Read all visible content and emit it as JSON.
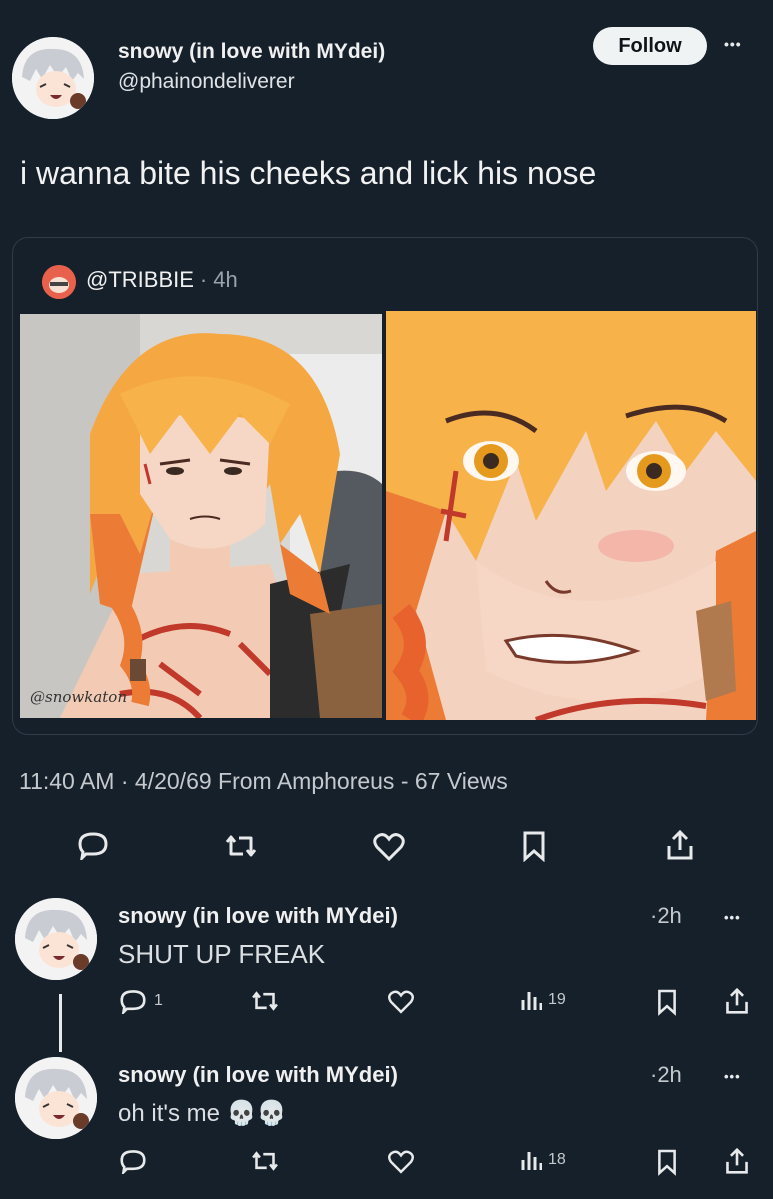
{
  "main_tweet": {
    "display_name": "snowy (in love with MYdei)",
    "handle": "@phainondeliverer",
    "follow_label": "Follow",
    "more_label": "•••",
    "text": "i wanna bite his cheeks and lick his nose",
    "quoted": {
      "handle": "@TRIBBIE",
      "separator": "·",
      "age": "4h",
      "signature": "@snowkaton"
    },
    "meta": "11:40 AM · 4/20/69 From Amphoreus - 67 Views"
  },
  "replies": [
    {
      "display_name": "snowy (in love with MYdei)",
      "age": "·2h",
      "text": "SHUT UP FREAK",
      "reply_count": "1",
      "views": "19",
      "more_label": "•••"
    },
    {
      "display_name": "snowy (in love with MYdei)",
      "age": "·2h",
      "text": "oh it's me 💀💀",
      "reply_count": "",
      "views": "18",
      "more_label": "•••"
    }
  ],
  "colors": {
    "background": "#15202b",
    "text": "#e7e9ea",
    "muted": "#c5c9cd",
    "hair": "#f5a742",
    "hair_tip": "#e8622d",
    "skin": "#f6d6c4",
    "mark": "#c0392b"
  }
}
